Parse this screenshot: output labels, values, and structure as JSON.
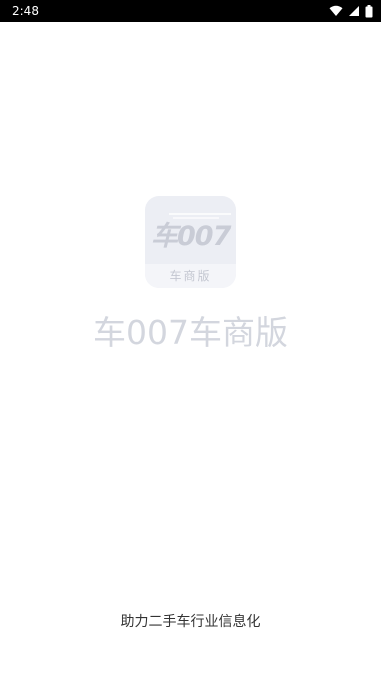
{
  "status_bar": {
    "time": "2:48",
    "icons": [
      "wifi-icon",
      "signal-icon",
      "battery-icon"
    ]
  },
  "splash": {
    "icon": {
      "logo_text": "车007",
      "sub_label": "车商版"
    },
    "app_name": "车007车商版",
    "slogan": "助力二手车行业信息化"
  },
  "colors": {
    "status_bar_bg": "#000000",
    "background": "#ffffff",
    "icon_bg": "#eceef4",
    "muted_text": "#d3d6de",
    "slogan_text": "#333333"
  }
}
